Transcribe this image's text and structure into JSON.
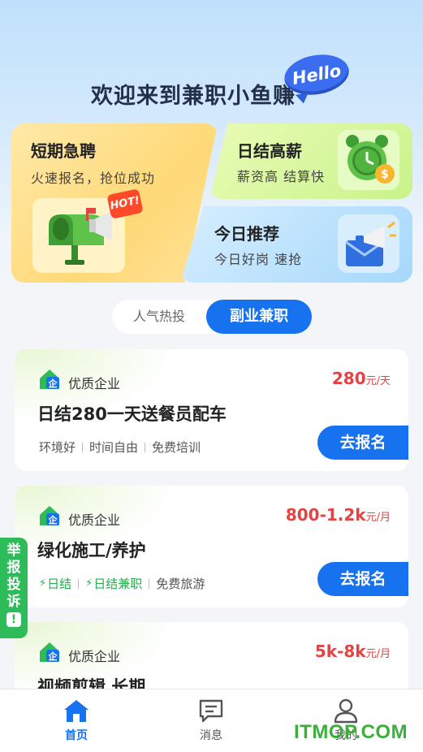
{
  "header": {
    "welcome": "欢迎来到兼职小鱼赚",
    "hello_badge": "Hello"
  },
  "feature_cards": {
    "short_term": {
      "title": "短期急聘",
      "subtitle": "火速报名，抢位成功",
      "badge": "HOT!"
    },
    "daily_pay": {
      "title": "日结高薪",
      "subtitle": "薪资高  结算快"
    },
    "today": {
      "title": "今日推荐",
      "subtitle": "今日好岗  速抢"
    }
  },
  "tabs": [
    {
      "label": "人气热投",
      "active": false
    },
    {
      "label": "副业兼职",
      "active": true
    }
  ],
  "jobs": [
    {
      "company": "优质企业",
      "salary": "280",
      "unit": "元/天",
      "title": "日结280一天送餐员配车",
      "tags": [
        "环境好",
        "时间自由",
        "免费培训"
      ],
      "apply": "去报名"
    },
    {
      "company": "优质企业",
      "salary": "800-1.2k",
      "unit": "元/月",
      "title": "绿化施工/养护",
      "tags": [
        "日结",
        "日结兼职",
        "免费旅游"
      ],
      "apply": "去报名"
    },
    {
      "company": "优质企业",
      "salary": "5k-8k",
      "unit": "元/月",
      "title": "视频剪辑 长期"
    }
  ],
  "report_button": {
    "label": "举报投诉",
    "icon": "!"
  },
  "bottom_nav": [
    {
      "label": "首页",
      "icon": "home-icon",
      "active": true
    },
    {
      "label": "消息",
      "icon": "message-icon",
      "active": false
    },
    {
      "label": "我的",
      "icon": "user-icon",
      "active": false
    }
  ],
  "watermark": "ITMOP.COM",
  "colors": {
    "accent": "#1772f0",
    "salary": "#e04444",
    "green": "#2ebb5a"
  }
}
